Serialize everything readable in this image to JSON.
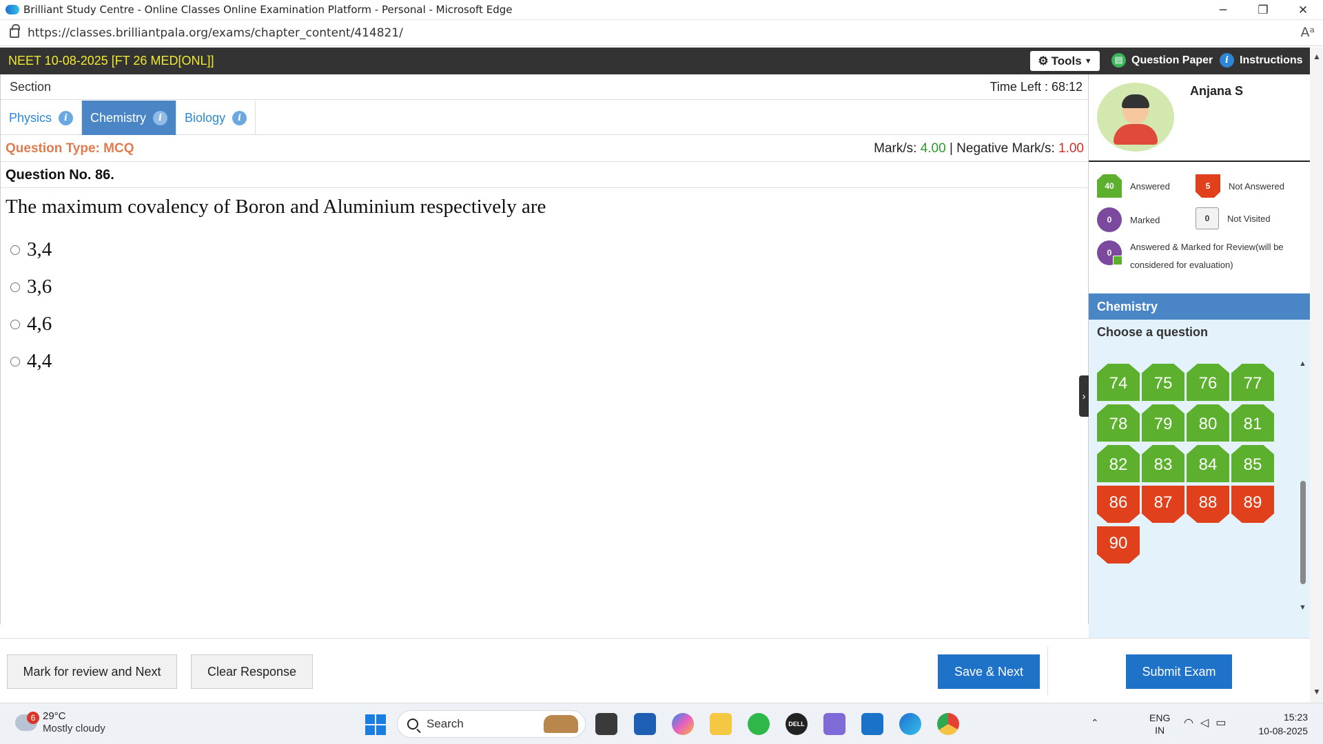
{
  "browser": {
    "window_title": "Brilliant Study Centre - Online Classes Online Examination Platform - Personal - Microsoft Edge",
    "url": "https://classes.brilliantpala.org/exams/chapter_content/414821/",
    "controls": {
      "minimize": "─",
      "maximize": "❐",
      "close": "✕"
    },
    "read_aloud": "Aᵃ"
  },
  "exam": {
    "title": "NEET 10-08-2025 [FT 26 MED[ONL]]",
    "tools_label": "Tools",
    "question_paper_label": "Question Paper",
    "instructions_label": "Instructions"
  },
  "section": {
    "label": "Section",
    "time_left": "Time Left : 68:12",
    "tabs": [
      {
        "label": "Physics",
        "active": false
      },
      {
        "label": "Chemistry",
        "active": true
      },
      {
        "label": "Biology",
        "active": false
      }
    ]
  },
  "question": {
    "type_label": "Question Type: MCQ",
    "marks_prefix": "Mark/s:",
    "marks_value": "4.00",
    "neg_prefix": "| Negative Mark/s:",
    "neg_value": "1.00",
    "number_label": "Question No. 86.",
    "text": "The maximum covalency of Boron and Aluminium respectively are",
    "options": [
      "3,4",
      "3,6",
      "4,6",
      "4,4"
    ]
  },
  "profile": {
    "name": "Anjana S"
  },
  "legend": {
    "answered": {
      "count": "40",
      "label": "Answered"
    },
    "not_answered": {
      "count": "5",
      "label": "Not Answered"
    },
    "marked": {
      "count": "0",
      "label": "Marked"
    },
    "not_visited": {
      "count": "0",
      "label": "Not Visited"
    },
    "answered_marked": {
      "count": "0",
      "label": "Answered & Marked for Review(will be considered for evaluation)"
    }
  },
  "palette": {
    "subject": "Chemistry",
    "choose_label": "Choose a question",
    "questions": [
      {
        "n": "74",
        "status": "answered"
      },
      {
        "n": "75",
        "status": "answered"
      },
      {
        "n": "76",
        "status": "answered"
      },
      {
        "n": "77",
        "status": "answered"
      },
      {
        "n": "78",
        "status": "answered"
      },
      {
        "n": "79",
        "status": "answered"
      },
      {
        "n": "80",
        "status": "answered"
      },
      {
        "n": "81",
        "status": "answered"
      },
      {
        "n": "82",
        "status": "answered"
      },
      {
        "n": "83",
        "status": "answered"
      },
      {
        "n": "84",
        "status": "answered"
      },
      {
        "n": "85",
        "status": "answered"
      },
      {
        "n": "86",
        "status": "not_answered"
      },
      {
        "n": "87",
        "status": "not_answered"
      },
      {
        "n": "88",
        "status": "not_answered"
      },
      {
        "n": "89",
        "status": "not_answered"
      },
      {
        "n": "90",
        "status": "not_answered"
      }
    ]
  },
  "footer": {
    "mark_review": "Mark for review and Next",
    "clear": "Clear Response",
    "save_next": "Save & Next",
    "submit": "Submit Exam"
  },
  "taskbar": {
    "weather_badge": "6",
    "temperature": "29°C",
    "condition": "Mostly cloudy",
    "search_label": "Search",
    "lang_line1": "ENG",
    "lang_line2": "IN",
    "time": "15:23",
    "date": "10-08-2025"
  },
  "colors": {
    "header_bg": "#333333",
    "exam_title": "#f2ea31",
    "tab_active": "#4a86c5",
    "answered": "#5cb02e",
    "not_answered": "#e0401c",
    "marked": "#7b4a9e",
    "primary_button": "#1e73c8",
    "palette_bg": "#e4f2fb"
  }
}
